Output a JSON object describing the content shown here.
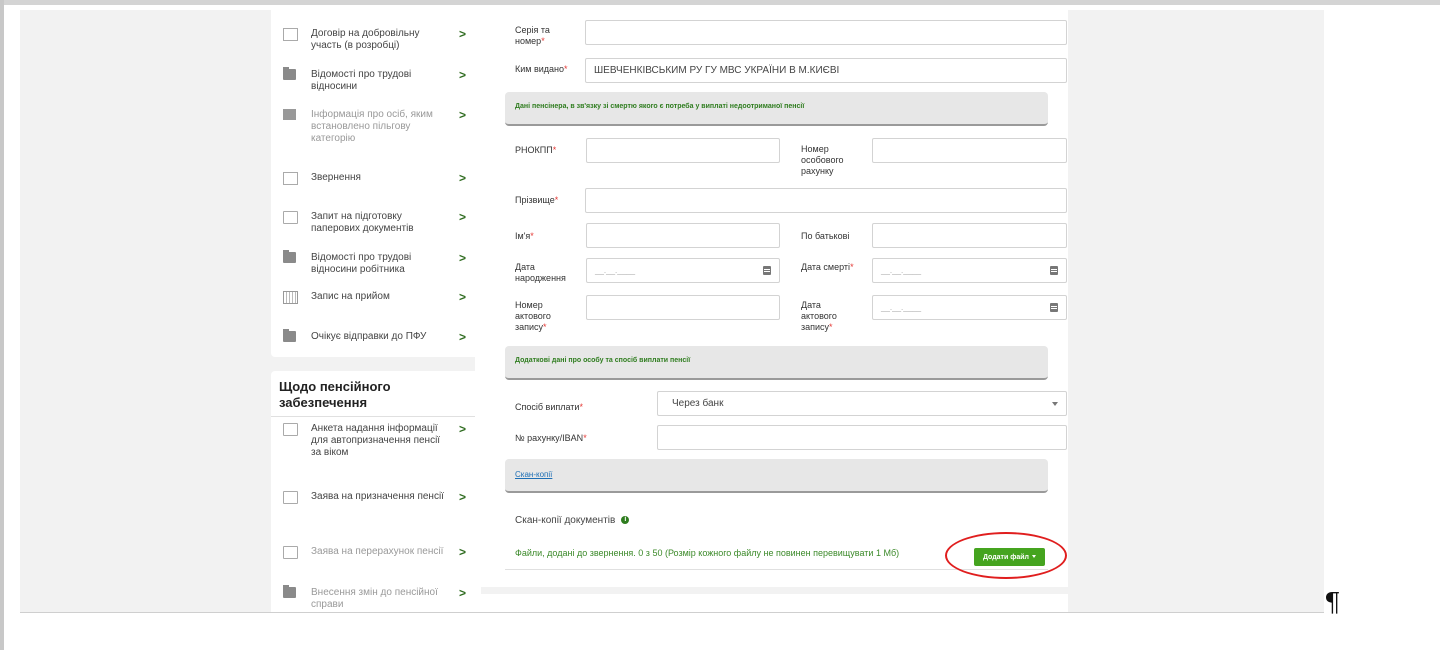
{
  "sidebar": {
    "items": [
      {
        "label": "Договір на добровільну участь (в розробці)",
        "icon": "envelope-outline-icon",
        "dim": false
      },
      {
        "label": "Відомості про трудові відносини",
        "icon": "folder-icon",
        "dim": false
      },
      {
        "label": "Інформація про осіб, яким встановлено пільгову категорію",
        "icon": "envelope-icon",
        "dim": true
      },
      {
        "label": "Звернення",
        "icon": "envelope-outline-icon",
        "dim": false
      },
      {
        "label": "Запит на підготовку паперових документів",
        "icon": "printer-icon",
        "dim": false
      },
      {
        "label": "Відомості про трудові відносини робітника",
        "icon": "folder-icon",
        "dim": false
      },
      {
        "label": "Запис на прийом",
        "icon": "calendar-icon",
        "dim": false
      },
      {
        "label": "Очікує відправки до ПФУ",
        "icon": "folder-icon",
        "dim": false
      }
    ],
    "section2_heading": "Щодо пенсійного забезпечення",
    "section2_items": [
      {
        "label": "Анкета надання інформації для автопризначення пенсії за віком",
        "icon": "form-icon",
        "dim": false
      },
      {
        "label": "Заява на призначення пенсії",
        "icon": "document-icon",
        "dim": false
      },
      {
        "label": "Заява на перерахунок пенсії",
        "icon": "recalc-icon",
        "dim": true
      },
      {
        "label": "Внесення змін до пенсійної справи",
        "icon": "folder-icon",
        "dim": true
      }
    ],
    "chevron": ">"
  },
  "form": {
    "series_label": "Серія та номер",
    "issued_label": "Ким видано",
    "issued_value": "ШЕВЧЕНКІВСЬКИМ РУ ГУ МВС УКРАЇНИ В М.КИЄВІ",
    "pensioner_section": "Дані пенсінера, в зв'язку зі смертю якого є потреба у виплаті недоотриманої пенсії",
    "rnokpp_label": "РНОКПП",
    "account_label": "Номер особового рахунку",
    "surname_label": "Прізвище",
    "name_label": "Ім'я",
    "patronymic_label": "По батькові",
    "birth_label": "Дата народження",
    "death_label": "Дата смерті",
    "act_number_label": "Номер актового запису",
    "act_date_label": "Дата актового запису",
    "date_placeholder": "__.__.____",
    "required_mark": "*",
    "extra_section": "Додаткові дані про особу та спосіб виплати пенсії",
    "payment_label": "Спосіб виплати",
    "payment_value": "Через банк",
    "iban_label": "№ рахунку/IBAN",
    "scans_section": "Скан-копії",
    "docs_label": "Скан-копії документів",
    "info_icon_text": "i",
    "files_note": "Файли, додані до звернення. 0 з 50 (Розмір кожного файлу не повинен перевищувати 1 Мб)",
    "add_file_button": "Додати файл"
  },
  "pilcrow": "¶",
  "colors": {
    "accent": "#45a41f",
    "highlight": "#e01e1e",
    "link": "#1e6fb5"
  }
}
